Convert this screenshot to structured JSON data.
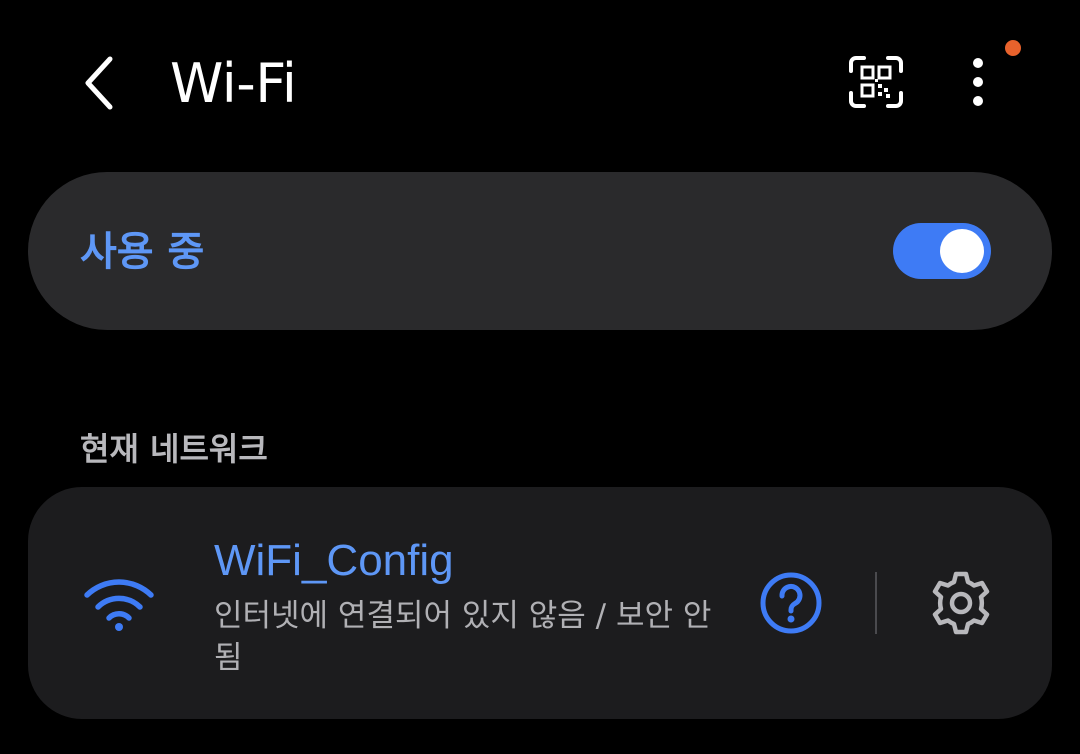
{
  "header": {
    "title": "Wi-Fi",
    "back_icon": "chevron-left-icon",
    "qr_icon": "qr-code-scan-icon",
    "more_icon": "more-vert-icon",
    "notification_dot_color": "#e8622c"
  },
  "master_toggle": {
    "label": "사용 중",
    "enabled": true,
    "label_color": "#5e97f6",
    "switch_color": "#3e7bf5"
  },
  "current_network_section": {
    "heading": "현재 네트워크",
    "network": {
      "ssid": "WiFi_Config",
      "status": "인터넷에 연결되어 있지 않음 / 보안 안됨",
      "ssid_color": "#5e97f6",
      "wifi_icon": "wifi-signal-icon",
      "help_icon": "question-circle-icon",
      "settings_icon": "gear-icon",
      "accent_color": "#3e7bf5"
    }
  }
}
